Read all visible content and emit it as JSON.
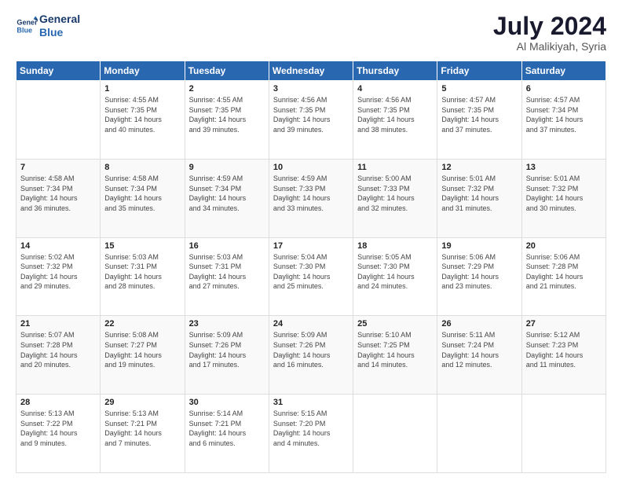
{
  "header": {
    "logo_line1": "General",
    "logo_line2": "Blue",
    "month": "July 2024",
    "location": "Al Malikiyah, Syria"
  },
  "weekdays": [
    "Sunday",
    "Monday",
    "Tuesday",
    "Wednesday",
    "Thursday",
    "Friday",
    "Saturday"
  ],
  "weeks": [
    [
      {
        "day": "",
        "content": ""
      },
      {
        "day": "1",
        "content": "Sunrise: 4:55 AM\nSunset: 7:35 PM\nDaylight: 14 hours\nand 40 minutes."
      },
      {
        "day": "2",
        "content": "Sunrise: 4:55 AM\nSunset: 7:35 PM\nDaylight: 14 hours\nand 39 minutes."
      },
      {
        "day": "3",
        "content": "Sunrise: 4:56 AM\nSunset: 7:35 PM\nDaylight: 14 hours\nand 39 minutes."
      },
      {
        "day": "4",
        "content": "Sunrise: 4:56 AM\nSunset: 7:35 PM\nDaylight: 14 hours\nand 38 minutes."
      },
      {
        "day": "5",
        "content": "Sunrise: 4:57 AM\nSunset: 7:35 PM\nDaylight: 14 hours\nand 37 minutes."
      },
      {
        "day": "6",
        "content": "Sunrise: 4:57 AM\nSunset: 7:34 PM\nDaylight: 14 hours\nand 37 minutes."
      }
    ],
    [
      {
        "day": "7",
        "content": "Sunrise: 4:58 AM\nSunset: 7:34 PM\nDaylight: 14 hours\nand 36 minutes."
      },
      {
        "day": "8",
        "content": "Sunrise: 4:58 AM\nSunset: 7:34 PM\nDaylight: 14 hours\nand 35 minutes."
      },
      {
        "day": "9",
        "content": "Sunrise: 4:59 AM\nSunset: 7:34 PM\nDaylight: 14 hours\nand 34 minutes."
      },
      {
        "day": "10",
        "content": "Sunrise: 4:59 AM\nSunset: 7:33 PM\nDaylight: 14 hours\nand 33 minutes."
      },
      {
        "day": "11",
        "content": "Sunrise: 5:00 AM\nSunset: 7:33 PM\nDaylight: 14 hours\nand 32 minutes."
      },
      {
        "day": "12",
        "content": "Sunrise: 5:01 AM\nSunset: 7:32 PM\nDaylight: 14 hours\nand 31 minutes."
      },
      {
        "day": "13",
        "content": "Sunrise: 5:01 AM\nSunset: 7:32 PM\nDaylight: 14 hours\nand 30 minutes."
      }
    ],
    [
      {
        "day": "14",
        "content": "Sunrise: 5:02 AM\nSunset: 7:32 PM\nDaylight: 14 hours\nand 29 minutes."
      },
      {
        "day": "15",
        "content": "Sunrise: 5:03 AM\nSunset: 7:31 PM\nDaylight: 14 hours\nand 28 minutes."
      },
      {
        "day": "16",
        "content": "Sunrise: 5:03 AM\nSunset: 7:31 PM\nDaylight: 14 hours\nand 27 minutes."
      },
      {
        "day": "17",
        "content": "Sunrise: 5:04 AM\nSunset: 7:30 PM\nDaylight: 14 hours\nand 25 minutes."
      },
      {
        "day": "18",
        "content": "Sunrise: 5:05 AM\nSunset: 7:30 PM\nDaylight: 14 hours\nand 24 minutes."
      },
      {
        "day": "19",
        "content": "Sunrise: 5:06 AM\nSunset: 7:29 PM\nDaylight: 14 hours\nand 23 minutes."
      },
      {
        "day": "20",
        "content": "Sunrise: 5:06 AM\nSunset: 7:28 PM\nDaylight: 14 hours\nand 21 minutes."
      }
    ],
    [
      {
        "day": "21",
        "content": "Sunrise: 5:07 AM\nSunset: 7:28 PM\nDaylight: 14 hours\nand 20 minutes."
      },
      {
        "day": "22",
        "content": "Sunrise: 5:08 AM\nSunset: 7:27 PM\nDaylight: 14 hours\nand 19 minutes."
      },
      {
        "day": "23",
        "content": "Sunrise: 5:09 AM\nSunset: 7:26 PM\nDaylight: 14 hours\nand 17 minutes."
      },
      {
        "day": "24",
        "content": "Sunrise: 5:09 AM\nSunset: 7:26 PM\nDaylight: 14 hours\nand 16 minutes."
      },
      {
        "day": "25",
        "content": "Sunrise: 5:10 AM\nSunset: 7:25 PM\nDaylight: 14 hours\nand 14 minutes."
      },
      {
        "day": "26",
        "content": "Sunrise: 5:11 AM\nSunset: 7:24 PM\nDaylight: 14 hours\nand 12 minutes."
      },
      {
        "day": "27",
        "content": "Sunrise: 5:12 AM\nSunset: 7:23 PM\nDaylight: 14 hours\nand 11 minutes."
      }
    ],
    [
      {
        "day": "28",
        "content": "Sunrise: 5:13 AM\nSunset: 7:22 PM\nDaylight: 14 hours\nand 9 minutes."
      },
      {
        "day": "29",
        "content": "Sunrise: 5:13 AM\nSunset: 7:21 PM\nDaylight: 14 hours\nand 7 minutes."
      },
      {
        "day": "30",
        "content": "Sunrise: 5:14 AM\nSunset: 7:21 PM\nDaylight: 14 hours\nand 6 minutes."
      },
      {
        "day": "31",
        "content": "Sunrise: 5:15 AM\nSunset: 7:20 PM\nDaylight: 14 hours\nand 4 minutes."
      },
      {
        "day": "",
        "content": ""
      },
      {
        "day": "",
        "content": ""
      },
      {
        "day": "",
        "content": ""
      }
    ]
  ]
}
